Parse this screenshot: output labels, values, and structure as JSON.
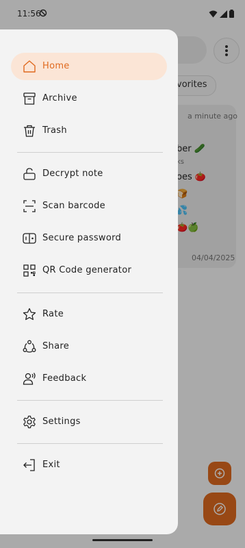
{
  "status_bar": {
    "time": "11:56"
  },
  "background": {
    "chip_label": "vorites",
    "card": {
      "time": "a minute ago",
      "lines": [
        "ber 🥒",
        "ks",
        "oes 🍅",
        "🍞",
        "💦",
        "🍅🍏"
      ],
      "date": "04/04/2025"
    }
  },
  "drawer": {
    "items": [
      {
        "label": "Home",
        "icon": "home-icon",
        "active": true
      },
      {
        "label": "Archive",
        "icon": "archive-icon"
      },
      {
        "label": "Trash",
        "icon": "trash-icon"
      },
      {
        "label": "Decrypt note",
        "icon": "unlock-icon"
      },
      {
        "label": "Scan barcode",
        "icon": "scan-icon"
      },
      {
        "label": "Secure password",
        "icon": "password-icon"
      },
      {
        "label": "QR Code generator",
        "icon": "qr-code-icon"
      },
      {
        "label": "Rate",
        "icon": "star-icon"
      },
      {
        "label": "Share",
        "icon": "share-icon"
      },
      {
        "label": "Feedback",
        "icon": "feedback-icon"
      },
      {
        "label": "Settings",
        "icon": "gear-icon"
      },
      {
        "label": "Exit",
        "icon": "exit-icon"
      }
    ]
  },
  "colors": {
    "accent": "#e06a1f",
    "active_bg": "#fbe5d6",
    "drawer_bg": "#f3f3f3"
  }
}
